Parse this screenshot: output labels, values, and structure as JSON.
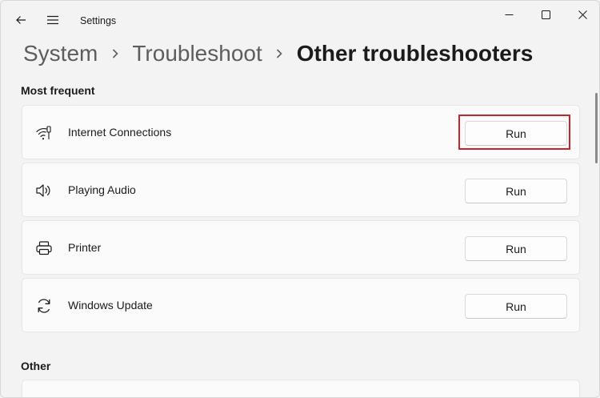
{
  "app": {
    "title": "Settings"
  },
  "breadcrumb": {
    "items": [
      "System",
      "Troubleshoot"
    ],
    "current": "Other troubleshooters",
    "separator": "›"
  },
  "sections": {
    "most_frequent": "Most frequent",
    "other": "Other"
  },
  "troubleshooters": [
    {
      "label": "Internet Connections",
      "icon": "wifi-icon",
      "button": "Run"
    },
    {
      "label": "Playing Audio",
      "icon": "speaker-icon",
      "button": "Run"
    },
    {
      "label": "Printer",
      "icon": "printer-icon",
      "button": "Run"
    },
    {
      "label": "Windows Update",
      "icon": "sync-icon",
      "button": "Run"
    }
  ],
  "colors": {
    "highlight": "#c4262e",
    "background": "#f3f3f3",
    "card": "#fbfbfb"
  }
}
